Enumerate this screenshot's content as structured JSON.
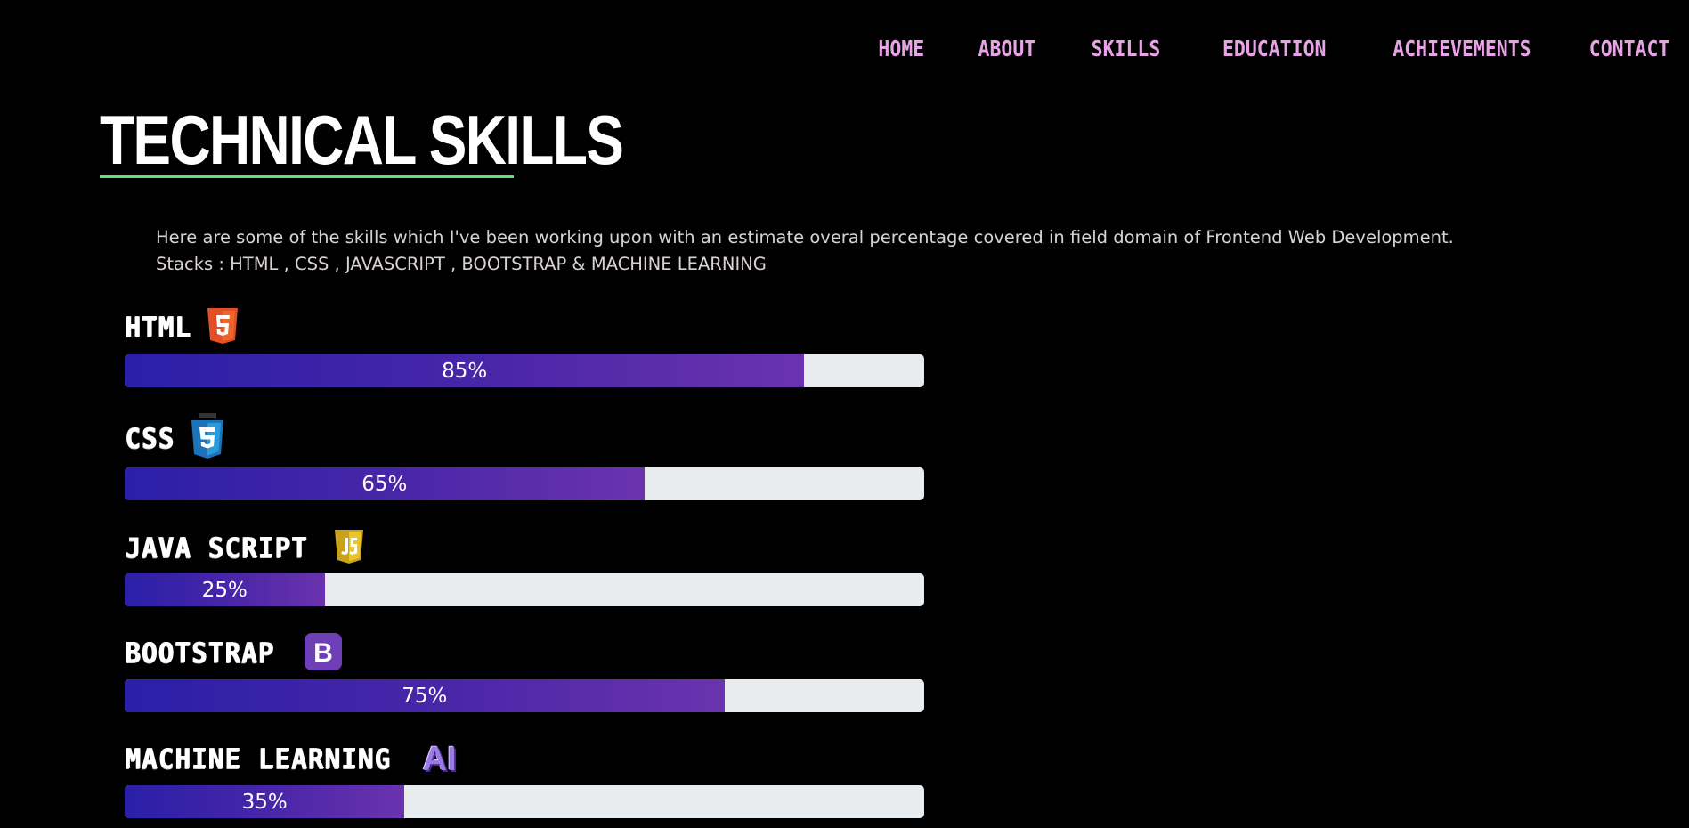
{
  "nav": {
    "items": [
      {
        "label": "HOME"
      },
      {
        "label": "ABOUT"
      },
      {
        "label": "SKILLS"
      },
      {
        "label": "EDUCATION"
      },
      {
        "label": "ACHIEVEMENTS"
      },
      {
        "label": "CONTACT"
      }
    ],
    "color": "#e8a2e6"
  },
  "section": {
    "title": "TECHNICAL SKILLS",
    "underline_color": "#5fe27a",
    "description_line1": "Here are some of the skills which I've been working upon with an estimate overal percentage covered in field domain of Frontend Web Development.",
    "description_line2": "Stacks : HTML , CSS , JAVASCRIPT , BOOTSTRAP & MACHINE LEARNING"
  },
  "skills": [
    {
      "name": "HTML",
      "icon": "html5-icon",
      "percent": 85,
      "percent_label": "85%"
    },
    {
      "name": "CSS",
      "icon": "css3-icon",
      "percent": 65,
      "percent_label": "65%"
    },
    {
      "name": "JAVA SCRIPT",
      "icon": "javascript-icon",
      "percent": 25,
      "percent_label": "25%"
    },
    {
      "name": "BOOTSTRAP",
      "icon": "bootstrap-icon",
      "percent": 75,
      "percent_label": "75%"
    },
    {
      "name": "MACHINE LEARNING",
      "icon": "ai-icon",
      "icon_text": "AI",
      "percent": 35,
      "percent_label": "35%"
    }
  ],
  "colors": {
    "bar_track": "#e8ecef",
    "bar_fill_start": "#2a1fa8",
    "bar_fill_end": "#6b33ae",
    "html5": "#e34f26",
    "css3": "#1b73ba",
    "javascript": "#e8c52a",
    "bootstrap": "#6f3fb8"
  }
}
